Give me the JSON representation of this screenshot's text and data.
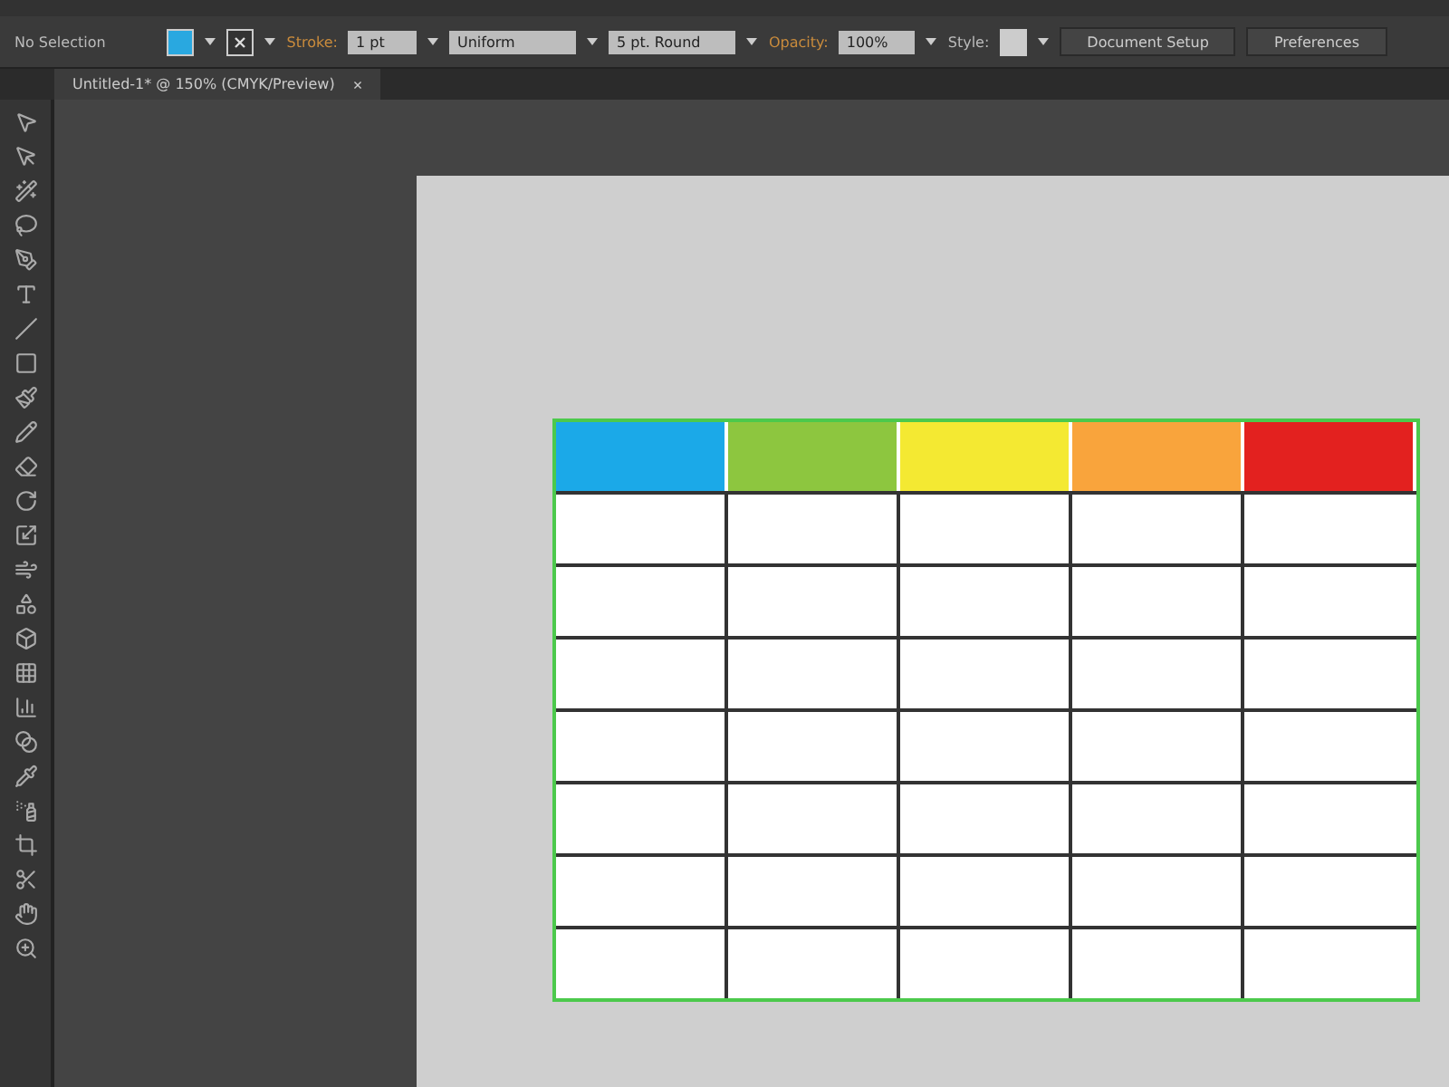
{
  "control_bar": {
    "selection_label": "No Selection",
    "stroke_label": "Stroke:",
    "stroke_weight": "1 pt",
    "stroke_profile": "Uniform",
    "brush": "5 pt. Round",
    "opacity_label": "Opacity:",
    "opacity": "100%",
    "style_label": "Style:",
    "buttons": [
      "Document Setup",
      "Preferences"
    ]
  },
  "document_tab": {
    "title": "Untitled-1* @ 150% (CMYK/Preview)",
    "close": "×"
  },
  "table": {
    "header_cells": [
      {
        "color": "#1ba9e8"
      },
      {
        "color": "#8dc63f"
      },
      {
        "color": "#f4e932"
      },
      {
        "color": "#f9a43c"
      },
      {
        "color": "#e3211f"
      }
    ]
  }
}
